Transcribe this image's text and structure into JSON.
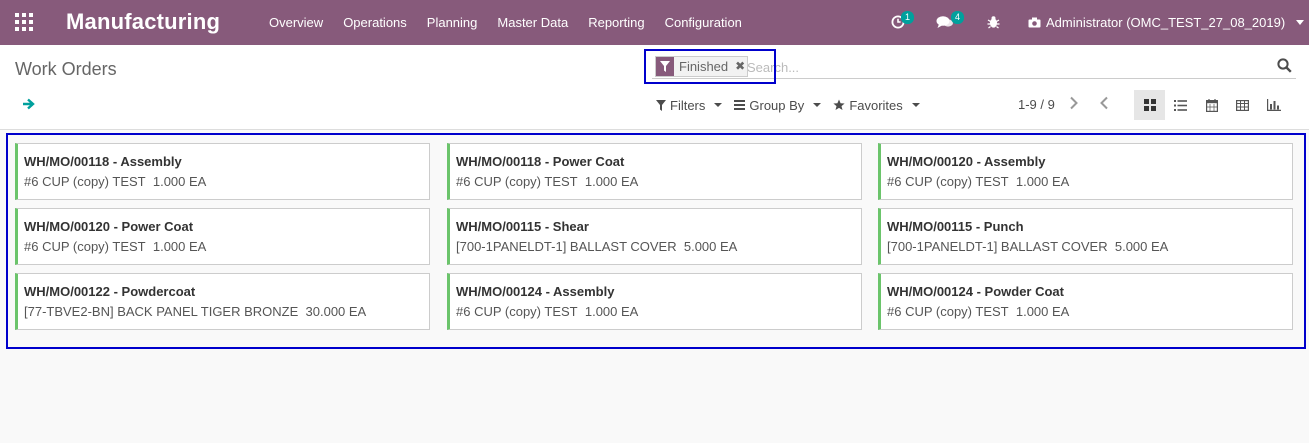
{
  "navbar": {
    "app_title": "Manufacturing",
    "menu": [
      "Overview",
      "Operations",
      "Planning",
      "Master Data",
      "Reporting",
      "Configuration"
    ],
    "activity_count": "1",
    "messages_count": "4",
    "user": "Administrator (OMC_TEST_27_08_2019)"
  },
  "control_panel": {
    "title": "Work Orders",
    "facet": "Finished",
    "search_placeholder": "Search...",
    "filters_label": "Filters",
    "groupby_label": "Group By",
    "favorites_label": "Favorites",
    "pager": "1-9 / 9"
  },
  "cards": [
    {
      "title": "WH/MO/00118 - Assembly",
      "product": "#6 CUP (copy) TEST",
      "qty": "1.000 EA"
    },
    {
      "title": "WH/MO/00118 - Power Coat",
      "product": "#6 CUP (copy) TEST",
      "qty": "1.000 EA"
    },
    {
      "title": "WH/MO/00120 - Assembly",
      "product": "#6 CUP (copy) TEST",
      "qty": "1.000 EA"
    },
    {
      "title": "WH/MO/00120 - Power Coat",
      "product": "#6 CUP (copy) TEST",
      "qty": "1.000 EA"
    },
    {
      "title": "WH/MO/00115 - Shear",
      "product": "[700-1PANELDT-1] BALLAST COVER",
      "qty": "5.000 EA"
    },
    {
      "title": "WH/MO/00115 - Punch",
      "product": "[700-1PANELDT-1] BALLAST COVER",
      "qty": "5.000 EA"
    },
    {
      "title": "WH/MO/00122 - Powdercoat",
      "product": "[77-TBVE2-BN] BACK PANEL TIGER BRONZE",
      "qty": "30.000 EA"
    },
    {
      "title": "WH/MO/00124 - Assembly",
      "product": "#6 CUP (copy) TEST",
      "qty": "1.000 EA"
    },
    {
      "title": "WH/MO/00124 - Powder Coat",
      "product": "#6 CUP (copy) TEST",
      "qty": "1.000 EA"
    }
  ],
  "colors": {
    "brand": "#875a7b",
    "accent": "#00a09d",
    "card_border": "#6bc46b"
  }
}
